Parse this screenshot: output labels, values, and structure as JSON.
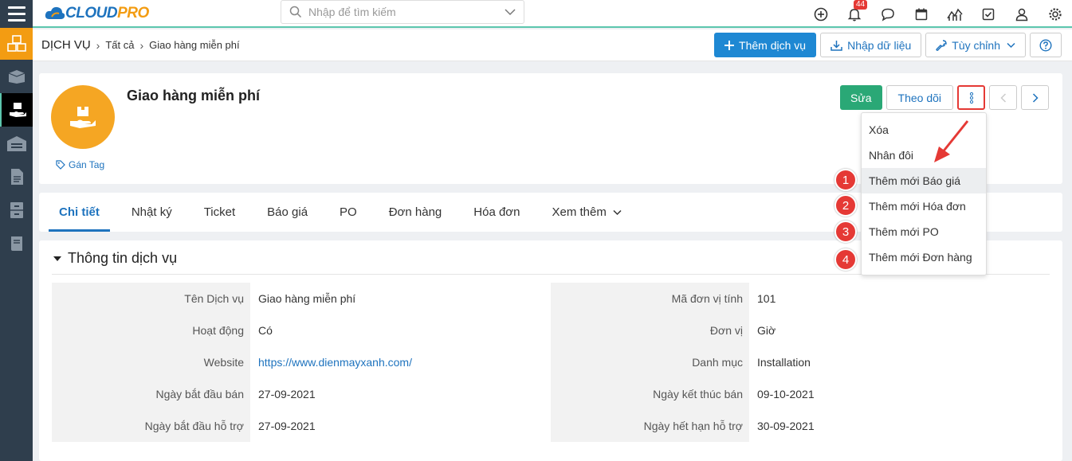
{
  "brand": {
    "name_cloud": "CLOUD",
    "name_pro": "PRO"
  },
  "search": {
    "placeholder": "Nhập để tìm kiếm"
  },
  "notifications": {
    "count": "44"
  },
  "breadcrumb": {
    "module": "DỊCH VỤ",
    "level1": "Tất cả",
    "level2": "Giao hàng miễn phí"
  },
  "toolbar": {
    "add_label": "Thêm dịch vụ",
    "import_label": "Nhập dữ liệu",
    "customize_label": "Tùy chỉnh"
  },
  "record": {
    "title": "Giao hàng miễn phí",
    "tag_label": "Gán Tag",
    "edit_label": "Sửa",
    "follow_label": "Theo dõi"
  },
  "tabs": [
    {
      "label": "Chi tiết"
    },
    {
      "label": "Nhật ký"
    },
    {
      "label": "Ticket"
    },
    {
      "label": "Báo giá"
    },
    {
      "label": "PO"
    },
    {
      "label": "Đơn hàng"
    },
    {
      "label": "Hóa đơn"
    },
    {
      "label": "Xem thêm"
    }
  ],
  "section": {
    "title": "Thông tin dịch vụ"
  },
  "fields_left": [
    {
      "label": "Tên Dịch vụ",
      "value": "Giao hàng miễn phí"
    },
    {
      "label": "Hoạt động",
      "value": "Có"
    },
    {
      "label": "Website",
      "value": "https://www.dienmayxanh.com/"
    },
    {
      "label": "Ngày bắt đầu bán",
      "value": "27-09-2021"
    },
    {
      "label": "Ngày bắt đầu hỗ trợ",
      "value": "27-09-2021"
    }
  ],
  "fields_right": [
    {
      "label": "Mã đơn vị tính",
      "value": "101"
    },
    {
      "label": "Đơn vị",
      "value": "Giờ"
    },
    {
      "label": "Danh mục",
      "value": "Installation"
    },
    {
      "label": "Ngày kết thúc bán",
      "value": "09-10-2021"
    },
    {
      "label": "Ngày hết hạn hỗ trợ",
      "value": "30-09-2021"
    }
  ],
  "menu": [
    {
      "label": "Xóa"
    },
    {
      "label": "Nhân đôi"
    },
    {
      "label": "Thêm mới Báo giá"
    },
    {
      "label": "Thêm mới Hóa đơn"
    },
    {
      "label": "Thêm mới PO"
    },
    {
      "label": "Thêm mới Đơn hàng"
    }
  ],
  "markers": [
    "1",
    "2",
    "3",
    "4"
  ],
  "colors": {
    "accent": "#1e88d3",
    "edit": "#2aa876",
    "avatar": "#f5a623",
    "sidebar": "#2f3e4d",
    "marker": "#e53935"
  }
}
